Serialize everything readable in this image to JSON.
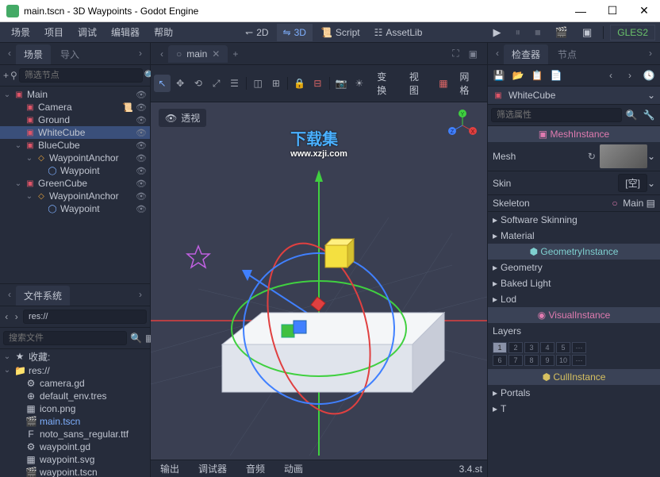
{
  "window": {
    "title": "main.tscn - 3D Waypoints - Godot Engine"
  },
  "menu": {
    "items": [
      "场景",
      "项目",
      "调试",
      "编辑器",
      "帮助"
    ]
  },
  "modes": {
    "d2": "2D",
    "d3": "3D",
    "script": "Script",
    "assetlib": "AssetLib"
  },
  "renderer": "GLES2",
  "dock_left_tabs": {
    "scene": "场景",
    "import": "导入"
  },
  "scene_filter_placeholder": "筛选节点",
  "scene_tree": [
    {
      "depth": 0,
      "name": "Main",
      "icon": "3d",
      "exp": "v"
    },
    {
      "depth": 1,
      "name": "Camera",
      "icon": "3d",
      "tail": "script"
    },
    {
      "depth": 1,
      "name": "Ground",
      "icon": "3d"
    },
    {
      "depth": 1,
      "name": "WhiteCube",
      "icon": "3d",
      "selected": true
    },
    {
      "depth": 1,
      "name": "BlueCube",
      "icon": "3d",
      "exp": "v"
    },
    {
      "depth": 2,
      "name": "WaypointAnchor",
      "icon": "wp",
      "exp": "v"
    },
    {
      "depth": 3,
      "name": "Waypoint",
      "icon": "grp"
    },
    {
      "depth": 1,
      "name": "GreenCube",
      "icon": "3d",
      "exp": "v"
    },
    {
      "depth": 2,
      "name": "WaypointAnchor",
      "icon": "wp",
      "exp": "v"
    },
    {
      "depth": 3,
      "name": "Waypoint",
      "icon": "grp"
    }
  ],
  "fs": {
    "title": "文件系统",
    "path": "res://",
    "search_placeholder": "搜索文件",
    "items": [
      {
        "name": "收藏:",
        "icon": "★",
        "exp": "v"
      },
      {
        "name": "res://",
        "icon": "📁",
        "exp": "v",
        "depth": 0
      },
      {
        "name": "camera.gd",
        "icon": "⚙",
        "depth": 1
      },
      {
        "name": "default_env.tres",
        "icon": "⊕",
        "depth": 1
      },
      {
        "name": "icon.png",
        "icon": "▦",
        "depth": 1
      },
      {
        "name": "main.tscn",
        "icon": "🎬",
        "depth": 1,
        "selected": true
      },
      {
        "name": "noto_sans_regular.ttf",
        "icon": "F",
        "depth": 1
      },
      {
        "name": "waypoint.gd",
        "icon": "⚙",
        "depth": 1
      },
      {
        "name": "waypoint.svg",
        "icon": "▦",
        "depth": 1
      },
      {
        "name": "waypoint.tscn",
        "icon": "🎬",
        "depth": 1
      }
    ]
  },
  "scene_tab": {
    "name": "main"
  },
  "viewport": {
    "perspective": "透视",
    "toolbar_right": {
      "transform": "变换",
      "view": "视图",
      "grid": "网格"
    },
    "watermark": "下载集",
    "watermark_url": "www.xzji.com"
  },
  "bottom": {
    "output": "输出",
    "debugger": "调试器",
    "audio": "音频",
    "anim": "动画",
    "version": "3.4.st"
  },
  "dock_right_tabs": {
    "inspector": "检查器",
    "node": "节点"
  },
  "inspector": {
    "node_name": "WhiteCube",
    "filter_placeholder": "筛选属性",
    "sections": {
      "mesh_instance": "MeshInstance",
      "geometry_instance": "GeometryInstance",
      "visual_instance": "VisualInstance",
      "cull_instance": "CullInstance"
    },
    "props": {
      "mesh": "Mesh",
      "skin": "Skin",
      "skin_val": "[空]",
      "skeleton": "Skeleton",
      "skeleton_val": "Main",
      "soft_skin": "Software Skinning",
      "material": "Material",
      "geometry": "Geometry",
      "baked_light": "Baked Light",
      "lod": "Lod",
      "layers": "Layers",
      "portals": "Portals",
      "t": "T"
    },
    "layers_grid": [
      [
        1,
        2,
        3,
        4,
        5
      ],
      [
        6,
        7,
        8,
        9,
        10
      ]
    ],
    "layer_on": 1
  }
}
